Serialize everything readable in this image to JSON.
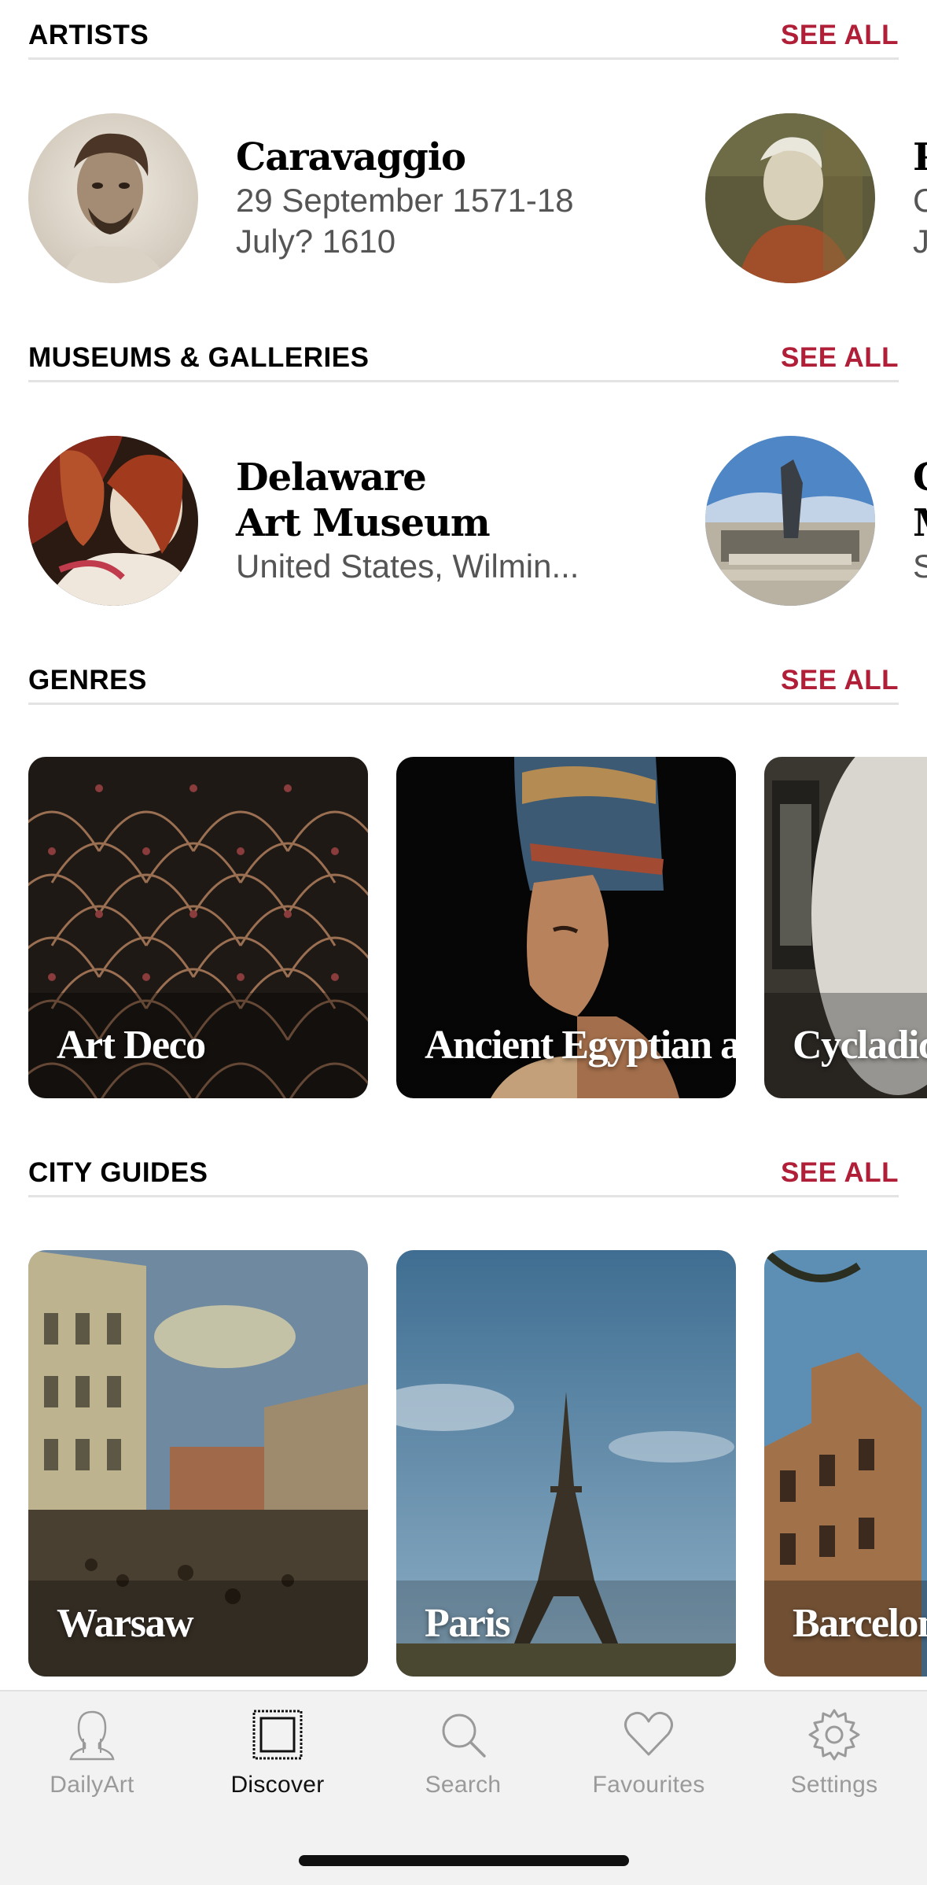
{
  "sections": {
    "artists": {
      "title": "ARTISTS",
      "see_all": "SEE ALL"
    },
    "museums": {
      "title": "MUSEUMS & GALLERIES",
      "see_all": "SEE ALL"
    },
    "genres": {
      "title": "GENRES",
      "see_all": "SEE ALL"
    },
    "city_guides": {
      "title": "CITY GUIDES",
      "see_all": "SEE ALL"
    }
  },
  "artists": [
    {
      "name": "Caravaggio",
      "line1": "29 September 1571-18",
      "line2": "July? 1610"
    },
    {
      "name": "P",
      "line1": "C",
      "line2": "J"
    }
  ],
  "museums": [
    {
      "name_line1": "Delaware",
      "name_line2": "Art Museum",
      "location": "United States, Wilmin..."
    },
    {
      "name_line1": "C",
      "name_line2": "M",
      "location": "S"
    }
  ],
  "genres": [
    {
      "label": "Art Deco"
    },
    {
      "label": "Ancient Egyptian art"
    },
    {
      "label": "Cycladic a"
    }
  ],
  "city_guides": [
    {
      "label": "Warsaw"
    },
    {
      "label": "Paris"
    },
    {
      "label": "Barcelona"
    }
  ],
  "tabbar": {
    "tabs": [
      {
        "label": "DailyArt",
        "icon": "bust-icon"
      },
      {
        "label": "Discover",
        "icon": "frame-icon",
        "active": true
      },
      {
        "label": "Search",
        "icon": "magnifier-icon"
      },
      {
        "label": "Favourites",
        "icon": "heart-icon"
      },
      {
        "label": "Settings",
        "icon": "gear-icon"
      }
    ]
  },
  "colors": {
    "accent": "#b01f37",
    "tab_inactive": "#9a9a9a",
    "tab_active": "#111111",
    "divider": "#e3e3e3"
  }
}
